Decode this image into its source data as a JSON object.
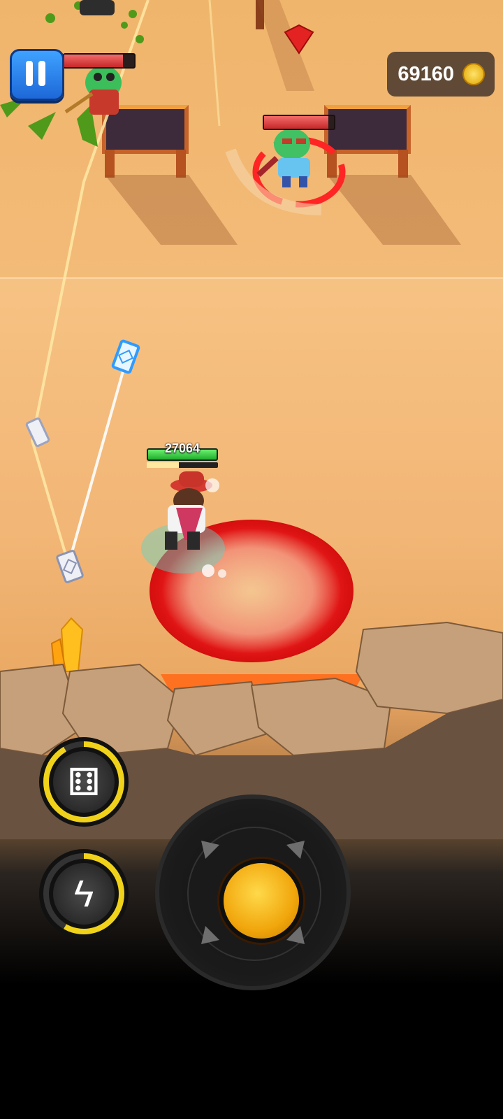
{
  "hud": {
    "coins": "69160",
    "player_hp": "27064",
    "pause_icon": "pause-icon",
    "coin_icon": "gold-hex-coin-icon"
  },
  "skills": [
    {
      "name": "dice-skill",
      "icon": "dice-icon",
      "glyph": "⚅"
    },
    {
      "name": "lightning-skill",
      "icon": "lightning-icon",
      "glyph": "ϟ"
    }
  ],
  "joystick": {
    "icon": "joystick-knob"
  },
  "colors": {
    "accent_yellow": "#f1c40f",
    "hp_red": "#d32f2f",
    "hp_green": "#2ecc40",
    "pause_blue": "#2b7ff0"
  }
}
